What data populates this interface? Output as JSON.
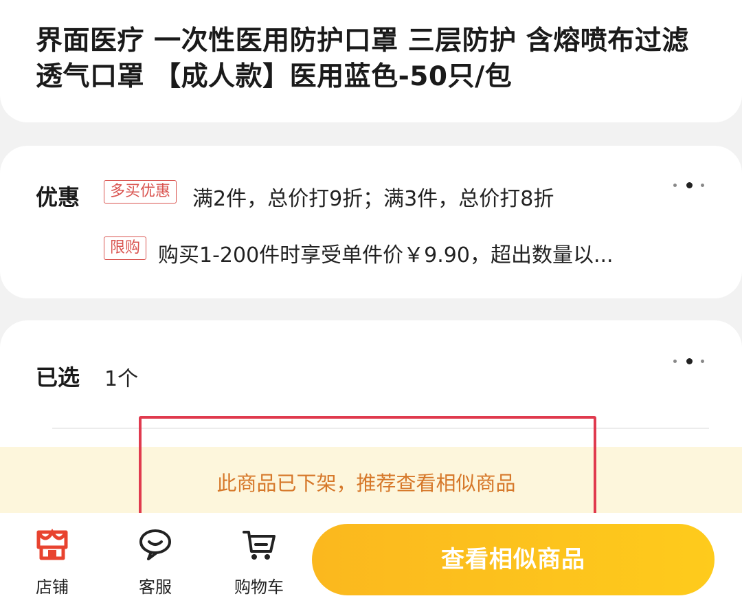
{
  "product": {
    "title": "界面医疗 一次性医用防护口罩 三层防护 含熔喷布过滤 透气口罩 【成人款】医用蓝色-50只/包"
  },
  "promotions": {
    "label": "优惠",
    "items": [
      {
        "tag": "多买优惠",
        "text": "满2件，总价打9折；满3件，总价打8折"
      },
      {
        "tag": "限购",
        "text": "购买1-200件时享受单件价￥9.90，超出数量以..."
      }
    ]
  },
  "selection": {
    "label": "已选",
    "value": "1个"
  },
  "notice": {
    "text": "此商品已下架，推荐查看相似商品"
  },
  "bottom_bar": {
    "store": {
      "label": "店铺",
      "icon": "store-icon"
    },
    "service": {
      "label": "客服",
      "icon": "chat-bubble-icon"
    },
    "cart": {
      "label": "购物车",
      "icon": "cart-icon"
    },
    "cta_label": "查看相似商品"
  },
  "colors": {
    "accent_red": "#d9534f",
    "notice_text": "#d6782a",
    "notice_bg": "#fdf6dc",
    "cta": "#fdc11c",
    "highlight_box": "#e03a4e"
  }
}
